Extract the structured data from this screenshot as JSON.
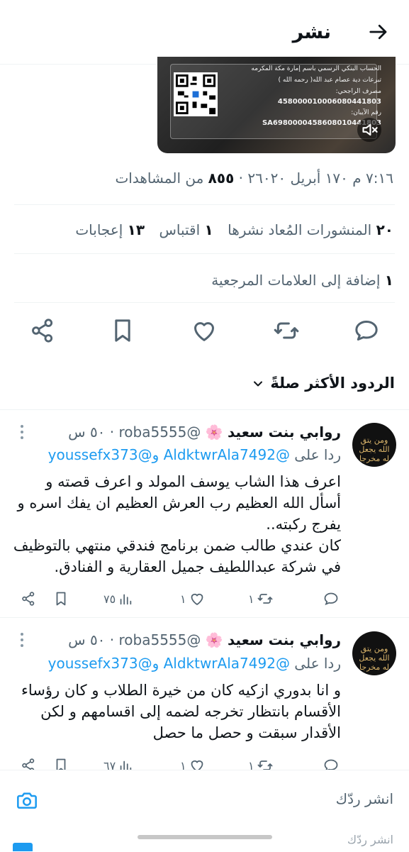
{
  "topbar": {
    "title": "نشر"
  },
  "media": {
    "lines": [
      "الحساب البنكي الرسمي باسم إمارة مكة المكرمه",
      "تبرعات دية عصام عبد الله( رحمه الله )",
      "مصرف الراجحي:",
      "458000010006080441803",
      "رقم الآيبان:",
      "SA6980000458608010441803"
    ]
  },
  "post": {
    "time_date": "٧:١٦ م ١٧٠ أبريل ٢٦٠٢٠",
    "views_count": "٨٥٥",
    "views_label": "من المشاهدات",
    "reposts_count": "٢٠",
    "reposts_label": "المنشورات المُعاد نشرها",
    "quotes_count": "١",
    "quotes_label": "اقتباس",
    "likes_count": "١٣",
    "likes_label": "إعجابات",
    "bookmarks_count": "١",
    "bookmarks_label": "إضافة إلى العلامات المرجعية"
  },
  "replies_header": "الردود الأكثر صلةً",
  "replies": [
    {
      "name": "روابي بنت سعيد",
      "flower": "🌸",
      "handle": "@roba5555",
      "time": "٥٠ س",
      "replying_prefix": "ردا على",
      "replying_to": "@AldktwrAla7492 و@youssefx373",
      "text": "اعرف هذا الشاب يوسف المولد و اعرف قصته و أسأل الله العظيم رب العرش العظيم ان يفك اسره و يفرج ركبته..\nكان عندي طالب ضمن برنامج فندقي منتهي بالتوظيف في شركة عبداللطيف جميل العقارية و الفنادق.",
      "replies_count": "",
      "reposts_count": "١",
      "likes_count": "١",
      "views_count": "٧٥"
    },
    {
      "name": "روابي بنت سعيد",
      "flower": "🌸",
      "handle": "@roba5555",
      "time": "٥٠ س",
      "replying_prefix": "ردا على",
      "replying_to": "@AldktwrAla7492 و@youssefx373",
      "text": "و انا بدوري ازكيه كان من خيرة الطلاب و كان رؤساء الأقسام بانتظار تخرجه لضمه إلى اقسامهم و لكن الأقدار سبقت و حصل ما حصل",
      "replies_count": "",
      "reposts_count": "١",
      "likes_count": "١",
      "views_count": "٦٧"
    }
  ],
  "avatar_text": "ومن يتق الله يجعل له مخرجا",
  "compose": {
    "placeholder": "انشر ردّك",
    "placeholder2": "انشر ردّك"
  },
  "colors": {
    "accent": "#1d9bf0",
    "muted": "#536471",
    "text": "#0f1419"
  }
}
